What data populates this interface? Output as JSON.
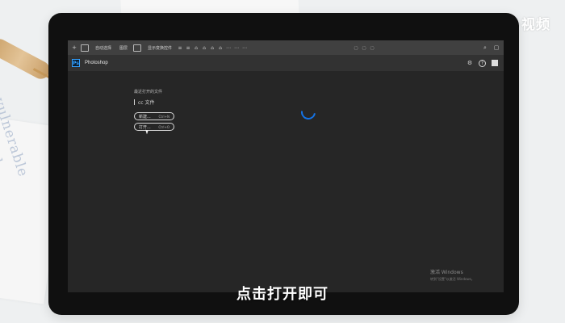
{
  "watermark": {
    "text": "天奇·视频"
  },
  "toolbar": {
    "items": [
      "+",
      "自动选择",
      "图层",
      "显示变换控件",
      "≡",
      "≡",
      "⌂",
      "⌂",
      "⌂",
      "⌂",
      "⋯",
      "⋯",
      "⋯",
      "◌",
      "◌",
      "◌",
      "⌕",
      "▢"
    ]
  },
  "app": {
    "title": "Photoshop",
    "icons": {
      "settings": "⚙",
      "help": "?",
      "search": "■"
    }
  },
  "home": {
    "recent_label": "最近打开的文件",
    "cc_label": "cc 文件",
    "new_button": {
      "label": "新建...",
      "shortcut": "Ctrl+N"
    },
    "open_button": {
      "label": "打开...",
      "shortcut": "Ctrl+O"
    }
  },
  "activation": {
    "line1": "激活 Windows",
    "line2": "转到\"设置\"以激活 Windows。"
  },
  "subtitle": {
    "text": "点击打开即可"
  },
  "colors": {
    "screen_background": "#262626",
    "toolbar_background": "#404040",
    "appbar_background": "#323232",
    "accent_blue": "#1473e6",
    "text_light": "#d9d9d9"
  }
}
